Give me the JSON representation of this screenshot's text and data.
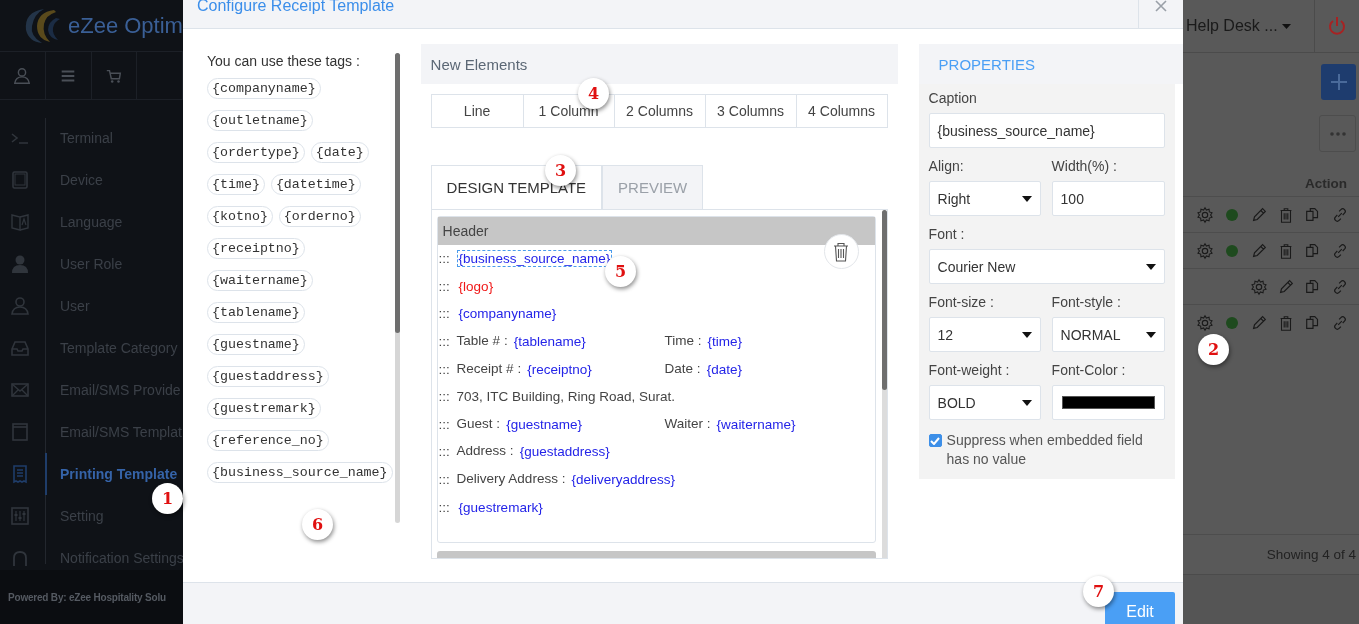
{
  "sidebar": {
    "logo_text": "eZee Optim",
    "toolbar": [
      {
        "kind": "user"
      },
      {
        "kind": "menu"
      },
      {
        "kind": "cart"
      }
    ],
    "items": [
      {
        "label": "Terminal",
        "selected": false
      },
      {
        "label": "Device",
        "selected": false
      },
      {
        "label": "Language",
        "selected": false
      },
      {
        "label": "User Role",
        "selected": false
      },
      {
        "label": "User",
        "selected": false
      },
      {
        "label": "Template Category",
        "selected": false
      },
      {
        "label": "Email/SMS Provide",
        "selected": false
      },
      {
        "label": "Email/SMS Templat",
        "selected": false
      },
      {
        "label": "Printing Template",
        "selected": true
      },
      {
        "label": "Setting",
        "selected": false
      },
      {
        "label": "Notification Settings",
        "selected": false
      }
    ],
    "footer": "Powered By: eZee Hospitality Solu"
  },
  "background": {
    "menu": "Help Desk ...",
    "action_header": "Action",
    "rows": [
      {
        "active": true,
        "deletable": true
      },
      {
        "active": true,
        "deletable": true
      },
      {
        "active": false,
        "deletable": false
      },
      {
        "active": true,
        "deletable": true
      }
    ],
    "summary": "Showing 4 of 4"
  },
  "modal": {
    "title": "Configure Receipt Template",
    "tags_heading": "You can use these tags :",
    "tags": [
      [
        "{companyname}"
      ],
      [
        "{outletname}"
      ],
      [
        "{ordertype}",
        "{date}"
      ],
      [
        "{time}",
        "{datetime}"
      ],
      [
        "{kotno}",
        "{orderno}"
      ],
      [
        "{receiptno}"
      ],
      [
        "{waitername}"
      ],
      [
        "{tablename}"
      ],
      [
        "{guestname}"
      ],
      [
        "{guestaddress}"
      ],
      [
        "{guestremark}"
      ],
      [
        "{reference_no}"
      ],
      [
        "{business_source_name}"
      ]
    ],
    "new_elements": {
      "title": "New Elements",
      "buttons": [
        "Line",
        "1 Column",
        "2 Columns",
        "3 Columns",
        "4 Columns"
      ]
    },
    "tabs": [
      {
        "label": "DESIGN TEMPLATE",
        "selected": true
      },
      {
        "label": "PREVIEW",
        "selected": false
      }
    ],
    "section": {
      "title": "Header",
      "rows": [
        {
          "handle": ":::",
          "cells": [
            {
              "tag": "{business_source_name}",
              "color": "#2424e8",
              "selected": true
            }
          ]
        },
        {
          "handle": ":::",
          "cells": [
            {
              "tag": "{logo}",
              "color": "#f01818",
              "selected": false
            }
          ]
        },
        {
          "handle": ":::",
          "cells": [
            {
              "tag": "{companyname}",
              "color": "#2424e8",
              "selected": false
            }
          ]
        },
        {
          "handle": ":::",
          "cells": [
            {
              "text": "Table # :",
              "tag": "{tablename}",
              "color": "#2424e8",
              "selected": false
            },
            {
              "text": "Time :",
              "tag": "{time}",
              "color": "#2424e8",
              "selected": false
            }
          ]
        },
        {
          "handle": ":::",
          "cells": [
            {
              "text": "Receipt # :",
              "tag": "{receiptno}",
              "color": "#2424e8",
              "selected": false
            },
            {
              "text": "Date :",
              "tag": "{date}",
              "color": "#2424e8",
              "selected": false
            }
          ]
        },
        {
          "handle": ":::",
          "cells": [
            {
              "text": "703, ITC Building, Ring Road, Surat."
            }
          ]
        },
        {
          "handle": ":::",
          "cells": [
            {
              "text": "Guest :",
              "tag": "{guestname}",
              "color": "#2424e8",
              "selected": false
            },
            {
              "text": "Waiter :",
              "tag": "{waitername}",
              "color": "#2424e8",
              "selected": false
            }
          ]
        },
        {
          "handle": ":::",
          "cells": [
            {
              "text": "Address :",
              "tag": "{guestaddress}",
              "color": "#2424e8",
              "selected": false
            }
          ]
        },
        {
          "handle": ":::",
          "cells": [
            {
              "text": "Delivery Address :",
              "tag": "{deliveryaddress}",
              "color": "#2424e8",
              "selected": false
            }
          ]
        },
        {
          "handle": ":::",
          "cells": [
            {
              "tag": "{guestremark}",
              "color": "#2424e8",
              "selected": false
            }
          ]
        }
      ]
    },
    "properties": {
      "title": "PROPERTIES",
      "rows": [
        [
          {
            "label": "Caption",
            "kind": "text",
            "value": "{business_source_name}"
          }
        ],
        [
          {
            "label": "Align:",
            "kind": "select",
            "value": "Right"
          },
          {
            "label": "Width(%) :",
            "kind": "text",
            "value": "100"
          }
        ],
        [
          {
            "label": "Font :",
            "kind": "select",
            "value": "Courier New"
          }
        ],
        [
          {
            "label": "Font-size :",
            "kind": "select",
            "value": "12"
          },
          {
            "label": "Font-style :",
            "kind": "select",
            "value": "NORMAL"
          }
        ],
        [
          {
            "label": "Font-weight :",
            "kind": "select",
            "value": "BOLD"
          },
          {
            "label": "Font-Color :",
            "kind": "color",
            "color": "#000000"
          }
        ]
      ],
      "checkbox": {
        "label": "Suppress when embedded field has no value",
        "checked": true
      }
    },
    "footer_button": "Edit"
  },
  "callouts": [
    "1",
    "2",
    "3",
    "4",
    "5",
    "6",
    "7"
  ]
}
